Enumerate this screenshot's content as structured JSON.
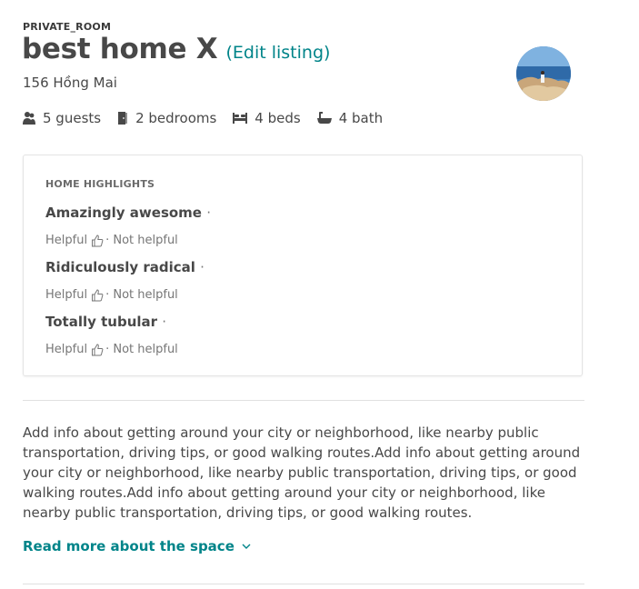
{
  "listing": {
    "room_type": "PRIVATE_ROOM",
    "title": "best home X",
    "edit_link": "(Edit listing)",
    "address": "156 Hồng Mai"
  },
  "amenities": [
    {
      "icon": "guests-icon",
      "label": "5 guests"
    },
    {
      "icon": "bedroom-door-icon",
      "label": "2 bedrooms"
    },
    {
      "icon": "bed-icon",
      "label": "4 beds"
    },
    {
      "icon": "bathtub-icon",
      "label": "4 bath"
    }
  ],
  "highlights": {
    "heading": "HOME HIGHLIGHTS",
    "separator": "·",
    "items": [
      {
        "title": "Amazingly awesome",
        "helpful": "Helpful",
        "not_helpful": "Not helpful"
      },
      {
        "title": "Ridiculously radical",
        "helpful": "Helpful",
        "not_helpful": "Not helpful"
      },
      {
        "title": "Totally tubular",
        "helpful": "Helpful",
        "not_helpful": "Not helpful"
      }
    ]
  },
  "description": "Add info about getting around your city or neighborhood, like nearby public transportation, driving tips, or good walking routes.Add info about getting around your city or neighborhood, like nearby public transportation, driving tips, or good walking routes.Add info about getting around your city or neighborhood, like nearby public transportation, driving tips, or good walking routes.",
  "read_more": "Read more about the space",
  "colors": {
    "accent": "#008489",
    "text": "#484848",
    "muted": "#767676",
    "border": "#e4e4e4"
  }
}
